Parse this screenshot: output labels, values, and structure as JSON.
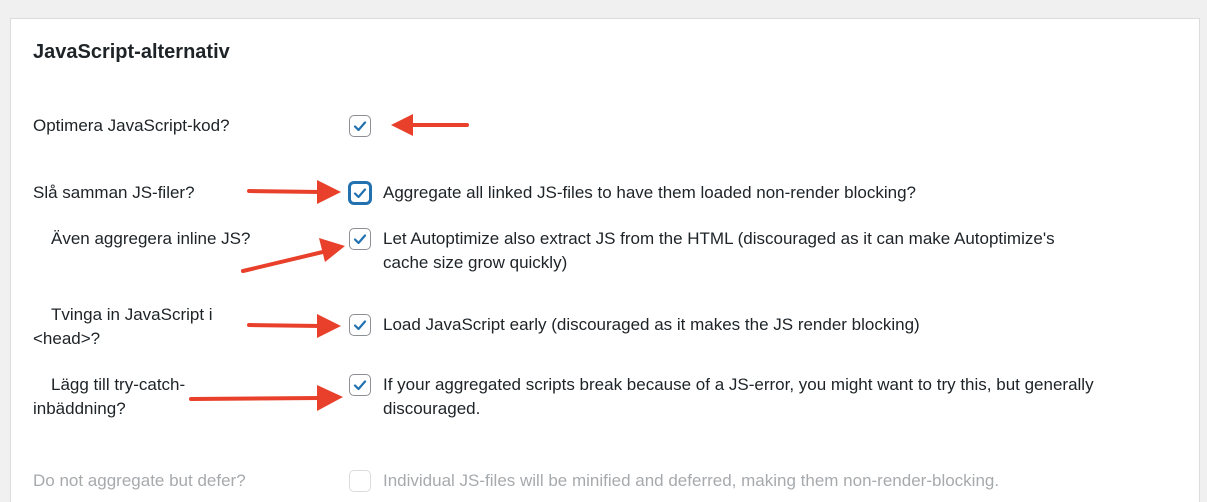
{
  "section": {
    "title": "JavaScript-alternativ"
  },
  "options": [
    {
      "label": "Optimera JavaScript-kod?",
      "description": "",
      "checked": true
    },
    {
      "label": "Slå samman JS-filer?",
      "description": "Aggregate all linked JS-files to have them loaded non-render blocking?",
      "checked": true
    },
    {
      "label": "Även aggregera inline JS?",
      "description": "Let Autoptimize also extract JS from the HTML (discouraged as it can make Autoptimize's cache size grow quickly)",
      "checked": true
    },
    {
      "label": "Tvinga in JavaScript i <head>?",
      "description": "Load JavaScript early (discouraged as it makes the JS render blocking)",
      "checked": true
    },
    {
      "label": "Lägg till try-catch-inbäddning?",
      "description": "If your aggregated scripts break because of a JS-error, you might want to try this, but generally discouraged.",
      "checked": true
    },
    {
      "label": "Do not aggregate but defer?",
      "description": "Individual JS-files will be minified and deferred, making them non-render-blocking.",
      "checked": false,
      "disabled": true
    }
  ],
  "colors": {
    "accent": "#2271b1",
    "annotation_arrow": "#e8402a",
    "disabled_text": "#a7aaad"
  }
}
